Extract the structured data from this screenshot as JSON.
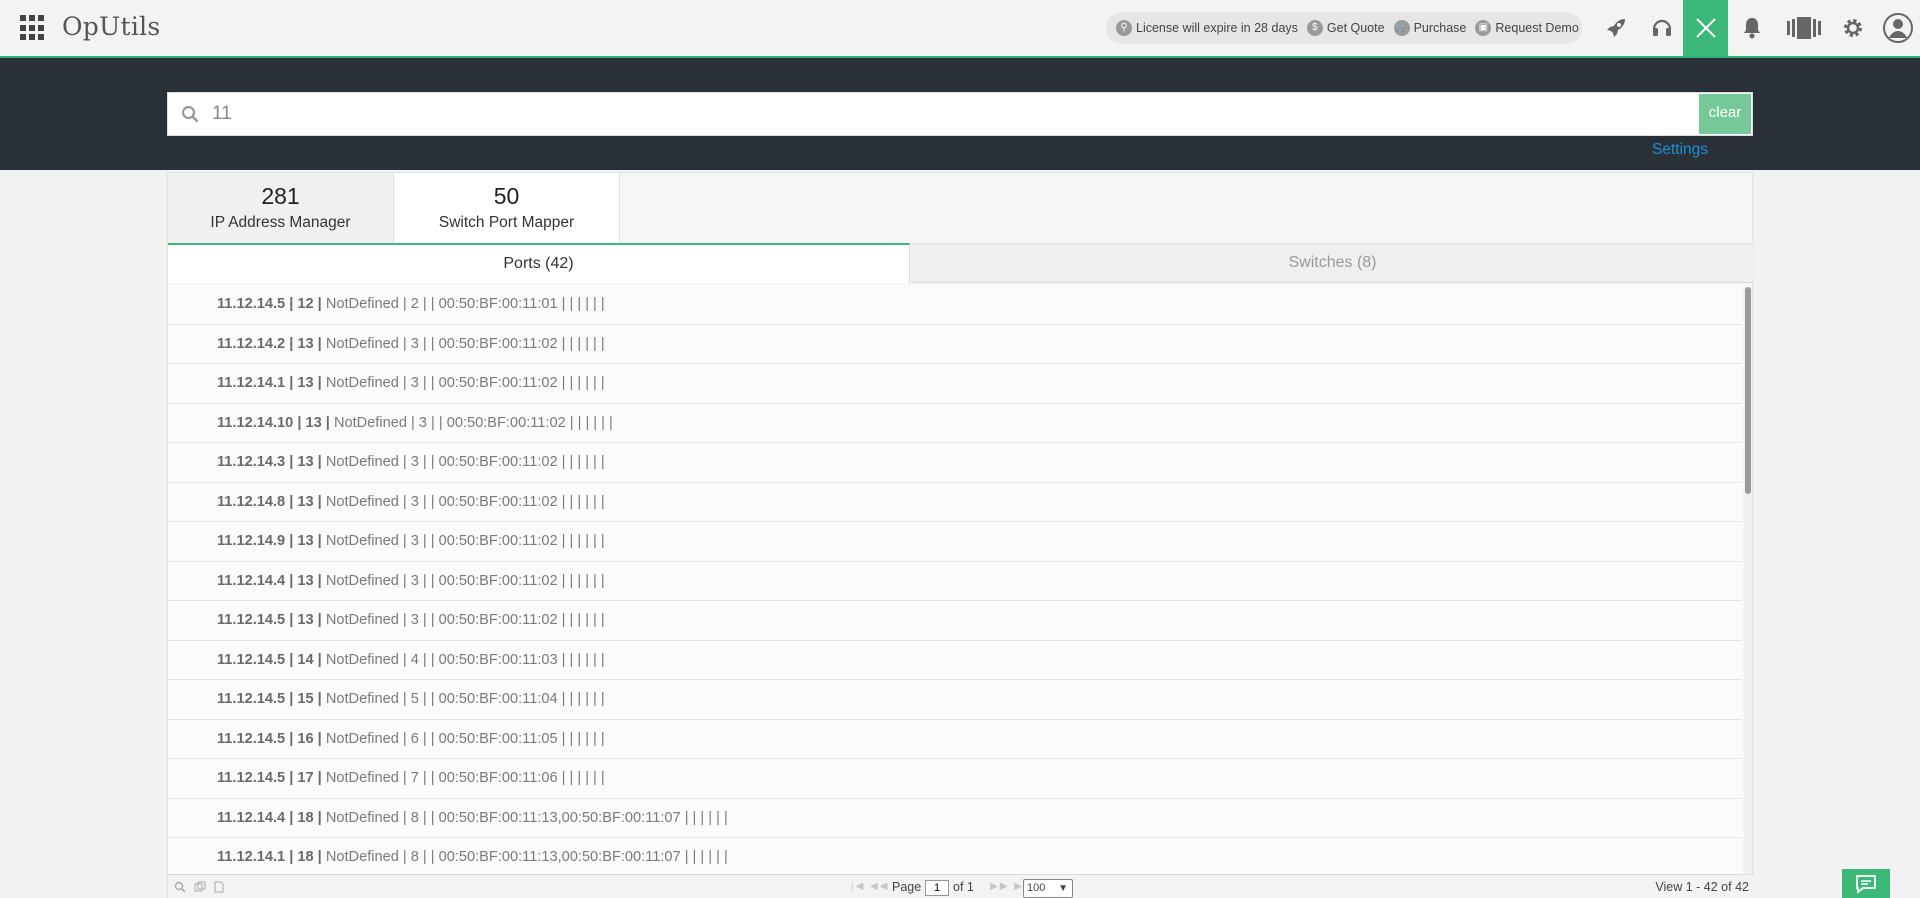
{
  "header": {
    "brand": "OpUtils",
    "license_notice": "License will expire in 28 days",
    "get_quote": "Get Quote",
    "purchase": "Purchase",
    "request_demo": "Request Demo"
  },
  "search": {
    "value": "11",
    "clear_label": "clear",
    "settings_label": "Settings"
  },
  "modules": [
    {
      "count": "281",
      "label": "IP Address Manager"
    },
    {
      "count": "50",
      "label": "Switch Port Mapper"
    }
  ],
  "subtabs": {
    "ports": "Ports (42)",
    "switches": "Switches (8)"
  },
  "rows": [
    {
      "ip": "11.12.14.5",
      "port": "12",
      "rest": "NotDefined | 2 |   | 00:50:BF:00:11:01 |  |  |  |  |  |"
    },
    {
      "ip": "11.12.14.2",
      "port": "13",
      "rest": "NotDefined | 3 |   | 00:50:BF:00:11:02 |  |  |  |  |  |"
    },
    {
      "ip": "11.12.14.1",
      "port": "13",
      "rest": "NotDefined | 3 |   | 00:50:BF:00:11:02 |  |  |  |  |  |"
    },
    {
      "ip": "11.12.14.10",
      "port": "13",
      "rest": "NotDefined | 3 |   | 00:50:BF:00:11:02 |  |  |  |  |  |"
    },
    {
      "ip": "11.12.14.3",
      "port": "13",
      "rest": "NotDefined | 3 |   | 00:50:BF:00:11:02 |  |  |  |  |  |"
    },
    {
      "ip": "11.12.14.8",
      "port": "13",
      "rest": "NotDefined | 3 |   | 00:50:BF:00:11:02 |  |  |  |  |  |"
    },
    {
      "ip": "11.12.14.9",
      "port": "13",
      "rest": "NotDefined | 3 |   | 00:50:BF:00:11:02 |  |  |  |  |  |"
    },
    {
      "ip": "11.12.14.4",
      "port": "13",
      "rest": "NotDefined | 3 |   | 00:50:BF:00:11:02 |  |  |  |  |  |"
    },
    {
      "ip": "11.12.14.5",
      "port": "13",
      "rest": "NotDefined | 3 |   | 00:50:BF:00:11:02 |  |  |  |  |  |"
    },
    {
      "ip": "11.12.14.5",
      "port": "14",
      "rest": "NotDefined | 4 |   | 00:50:BF:00:11:03 |  |  |  |  |  |"
    },
    {
      "ip": "11.12.14.5",
      "port": "15",
      "rest": "NotDefined | 5 |   | 00:50:BF:00:11:04 |  |  |  |  |  |"
    },
    {
      "ip": "11.12.14.5",
      "port": "16",
      "rest": "NotDefined | 6 |   | 00:50:BF:00:11:05 |  |  |  |  |  |"
    },
    {
      "ip": "11.12.14.5",
      "port": "17",
      "rest": "NotDefined | 7 |   | 00:50:BF:00:11:06 |  |  |  |  |  |"
    },
    {
      "ip": "11.12.14.4",
      "port": "18",
      "rest": "NotDefined | 8 |   | 00:50:BF:00:11:13,00:50:BF:00:11:07 |  |  |  |  |  |"
    },
    {
      "ip": "11.12.14.1",
      "port": "18",
      "rest": "NotDefined | 8 |   | 00:50:BF:00:11:13,00:50:BF:00:11:07 |  |  |  |  |  |"
    }
  ],
  "pager": {
    "page_label": "Page",
    "page_value": "1",
    "of_label": "of 1",
    "page_size": "100",
    "range": "View 1 - 42 of 42"
  },
  "colors": {
    "accent": "#3cb879",
    "band": "#2a3038",
    "link": "#1e8fd6"
  }
}
